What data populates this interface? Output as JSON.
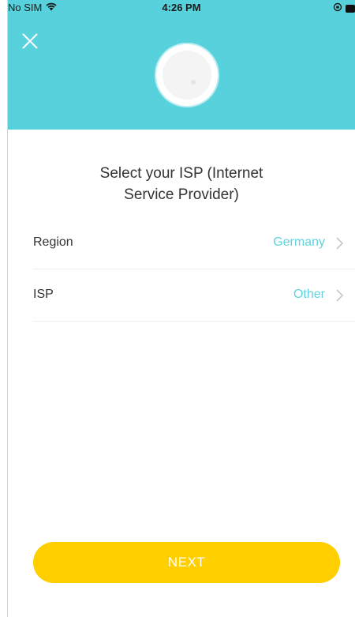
{
  "status_bar": {
    "carrier": "No SIM",
    "time": "4:26 PM"
  },
  "icons": {
    "wifi": "wifi-icon",
    "close": "close-icon",
    "chevron": "chevron-right-icon",
    "orientation_lock": "orientation-lock-icon",
    "battery": "battery-icon"
  },
  "colors": {
    "header_bg": "#57d2dc",
    "accent_text": "#5ed3dd",
    "button_bg": "#ffcf00",
    "button_text": "#ffffff"
  },
  "title": {
    "line1": "Select your ISP (Internet",
    "line2": "Service Provider)"
  },
  "rows": [
    {
      "label": "Region",
      "value": "Germany"
    },
    {
      "label": "ISP",
      "value": "Other"
    }
  ],
  "next_button": {
    "label": "NEXT"
  }
}
